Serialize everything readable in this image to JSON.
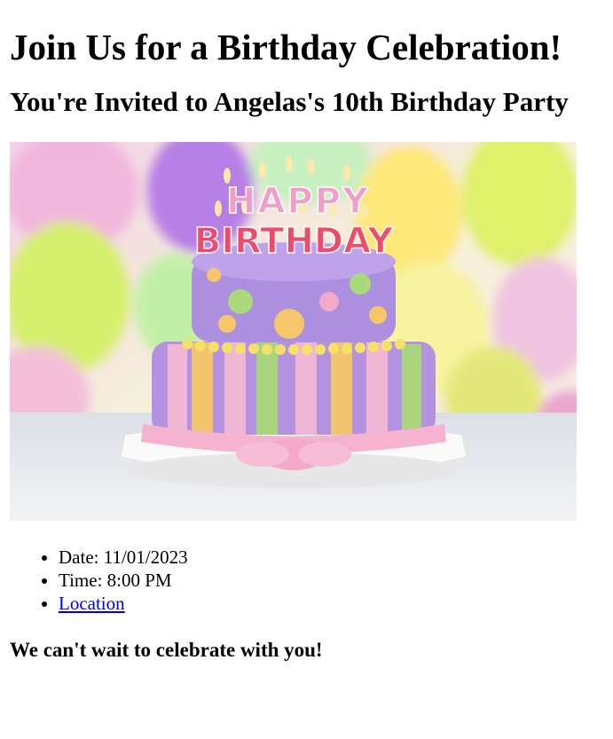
{
  "page": {
    "heading": "Join Us for a Birthday Celebration!",
    "subheading": "You're Invited to Angelas's 10th Birthday Party",
    "image": {
      "candle_top": "HAPPY",
      "candle_bottom": "BIRTHDAY"
    },
    "details": {
      "date": "Date: 11/01/2023",
      "time": "Time: 8:00 PM",
      "location": "Location"
    },
    "closing": "We can't wait to celebrate with you!"
  },
  "colors": {
    "link": "#0000ee",
    "text": "#000000"
  }
}
